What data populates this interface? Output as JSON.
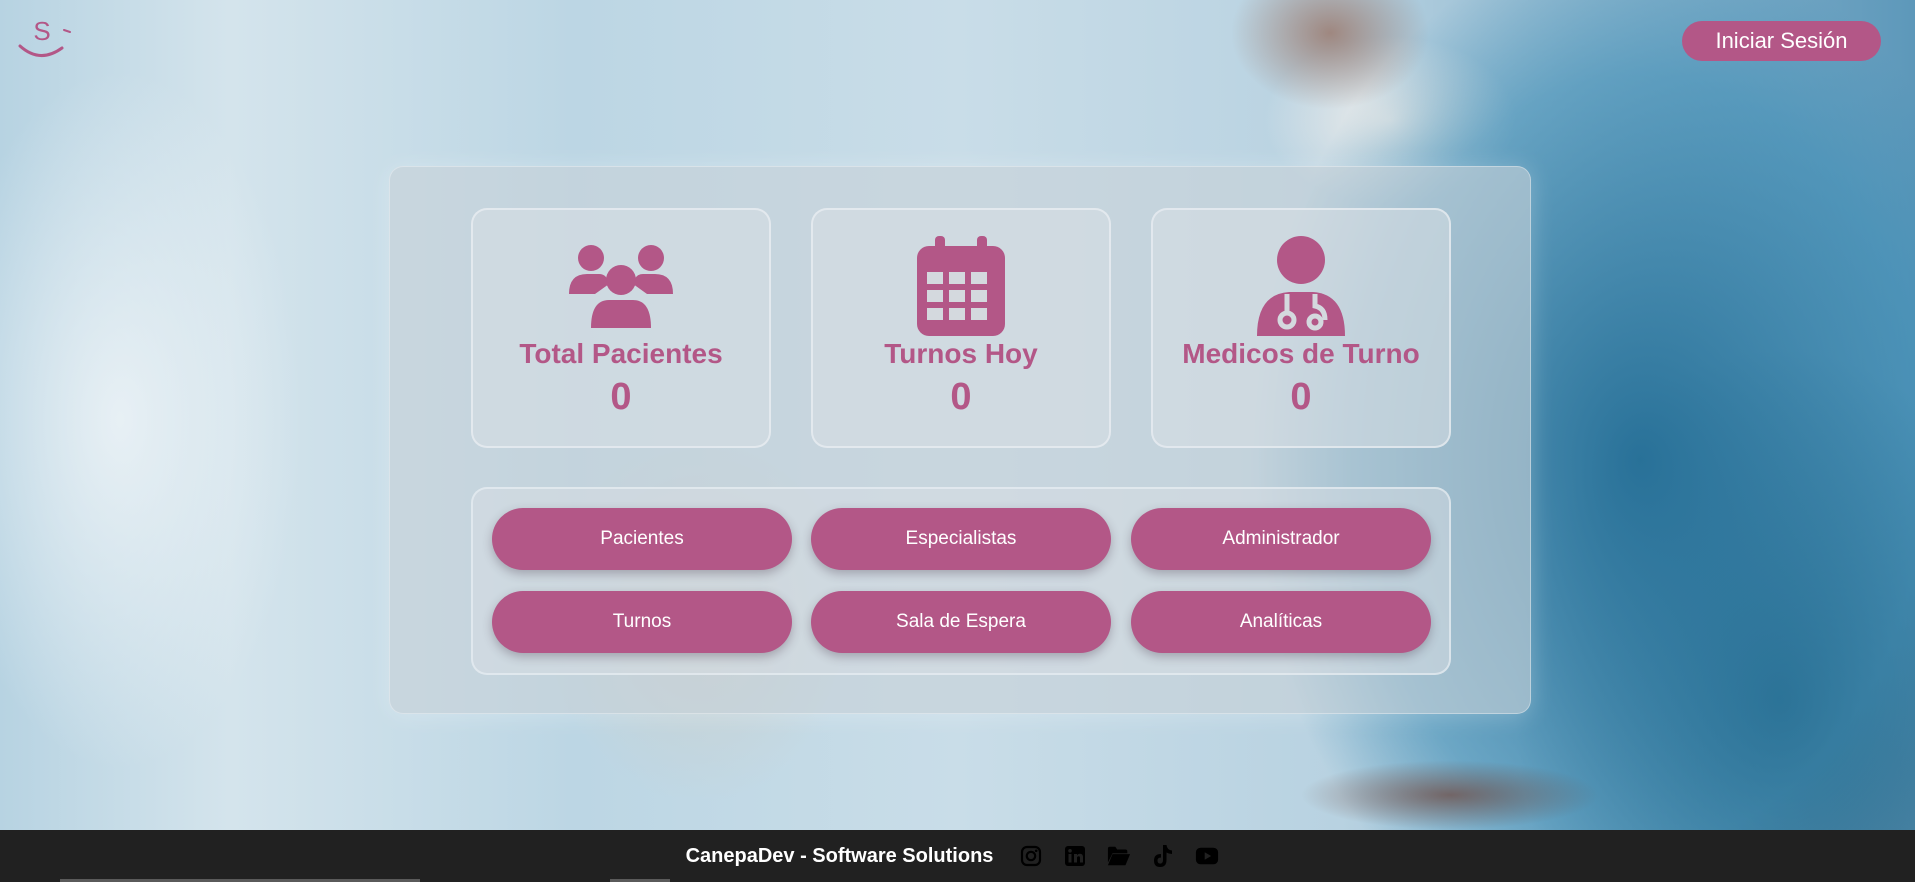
{
  "header": {
    "logo_letter": "S",
    "login_label": "Iniciar Sesión"
  },
  "stats": [
    {
      "icon": "patients-group-icon",
      "title": "Total Pacientes",
      "value": "0"
    },
    {
      "icon": "calendar-icon",
      "title": "Turnos Hoy",
      "value": "0"
    },
    {
      "icon": "doctor-icon",
      "title": "Medicos de Turno",
      "value": "0"
    }
  ],
  "nav_buttons": [
    {
      "label": "Pacientes"
    },
    {
      "label": "Especialistas"
    },
    {
      "label": "Administrador"
    },
    {
      "label": "Turnos"
    },
    {
      "label": "Sala de Espera"
    },
    {
      "label": "Analíticas"
    }
  ],
  "footer": {
    "brand": "CanepaDev - Software Solutions",
    "social_icons": [
      "instagram-icon",
      "linkedin-icon",
      "folder-icon",
      "tiktok-icon",
      "youtube-icon"
    ]
  },
  "colors": {
    "accent": "#b35787",
    "footer_bg": "#212121",
    "button_text": "#ffffff"
  }
}
